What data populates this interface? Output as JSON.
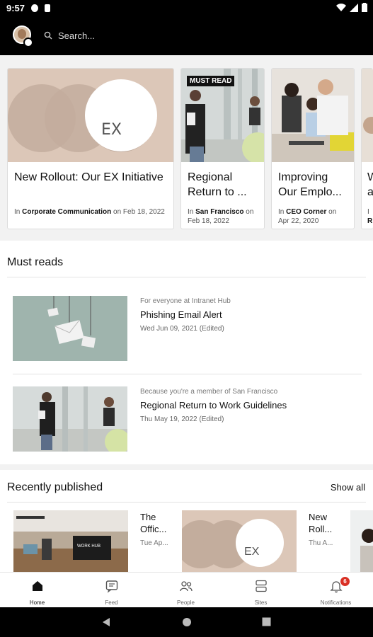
{
  "status_bar": {
    "time": "9:57"
  },
  "header": {
    "search_placeholder": "Search..."
  },
  "carousel": {
    "cards": [
      {
        "title": "New Rollout: Our EX Initiative",
        "meta_prefix": "In",
        "meta_place": "Corporate Communication",
        "meta_date": "on Feb 18, 2022",
        "image_text": "EX"
      },
      {
        "title": "Regional Return to ...",
        "badge": "MUST READ",
        "meta_prefix": "In",
        "meta_place": "San Francisco",
        "meta_date": "on Feb 18, 2022"
      },
      {
        "title": "Improving Our Emplo...",
        "meta_prefix": "In",
        "meta_place": "CEO Corner",
        "meta_date": "on Apr 22, 2020"
      },
      {
        "title": "W a",
        "meta_prefix": "I",
        "meta_place": "R"
      }
    ]
  },
  "must_reads": {
    "title": "Must reads",
    "items": [
      {
        "context": "For everyone at Intranet Hub",
        "title": "Phishing Email Alert",
        "date": "Wed Jun 09, 2021 (Edited)"
      },
      {
        "context": "Because you're a member of San Francisco",
        "title": "Regional Return to Work Guidelines",
        "date": "Thu May 19, 2022 (Edited)"
      }
    ]
  },
  "recently_published": {
    "title": "Recently published",
    "show_all": "Show all",
    "items": [
      {
        "title": "The Offic...",
        "sub": "Tue Ap...",
        "sign_text": "WORK HUB"
      },
      {
        "title": "New Roll...",
        "sub": "Thu A...",
        "image_text": "EX"
      }
    ]
  },
  "bottom_nav": {
    "items": [
      {
        "label": "Home",
        "icon": "home-icon",
        "active": true
      },
      {
        "label": "Feed",
        "icon": "feed-icon"
      },
      {
        "label": "People",
        "icon": "people-icon"
      },
      {
        "label": "Sites",
        "icon": "sites-icon"
      },
      {
        "label": "Notifications",
        "icon": "bell-icon",
        "badge": "6"
      }
    ]
  },
  "colors": {
    "header_bg": "#000000",
    "card_peach": "#dcc7b8",
    "circle_gray": "#c7b3a4",
    "notif_red": "#d93025"
  }
}
